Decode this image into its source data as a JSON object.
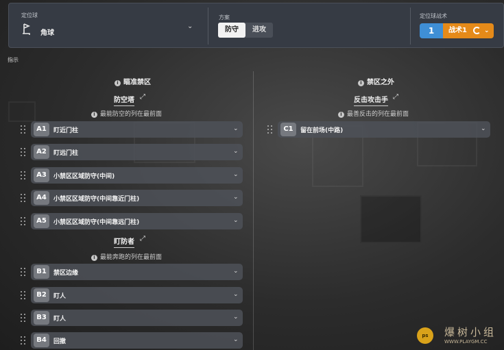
{
  "header": {
    "category_label": "定位球",
    "category_value": "角球",
    "plan_label": "方案",
    "plan_tabs": [
      {
        "label": "防守",
        "active": true
      },
      {
        "label": "进攻",
        "active": false
      }
    ],
    "tactic_label": "定位球战术",
    "tactic_number": "1",
    "tactic_name": "战术1",
    "colors": {
      "tactic_number_bg": "#3f8fd6",
      "tactic_name_bg": "#e58a19"
    }
  },
  "instructions_label": "指示",
  "left": {
    "title": "瞄准禁区",
    "groups": [
      {
        "title": "防空塔",
        "hint": "最能防空的列在最前面",
        "rows": [
          {
            "code": "A1",
            "label": "盯近门柱"
          },
          {
            "code": "A2",
            "label": "盯远门柱"
          },
          {
            "code": "A3",
            "label": "小禁区区域防守(中间)"
          },
          {
            "code": "A4",
            "label": "小禁区区域防守(中间靠近门柱)"
          },
          {
            "code": "A5",
            "label": "小禁区区域防守(中间靠远门柱)"
          }
        ]
      },
      {
        "title": "盯防者",
        "hint": "最能奔跑的列在最前面",
        "rows": [
          {
            "code": "B1",
            "label": "禁区边缘"
          },
          {
            "code": "B2",
            "label": "盯人"
          },
          {
            "code": "B3",
            "label": "盯人"
          },
          {
            "code": "B4",
            "label": "回撤"
          }
        ]
      }
    ]
  },
  "right": {
    "title": "禁区之外",
    "groups": [
      {
        "title": "反击攻击手",
        "hint": "最善反击的列在最前面",
        "rows": [
          {
            "code": "C1",
            "label": "留在前场(中路)"
          }
        ]
      }
    ]
  },
  "watermark": {
    "text": "爆树小组",
    "url": "WWW.PLAYGM.CC",
    "logo": "ps"
  },
  "icons": {
    "category": "corner-flag-icon",
    "dropdown": "chevron-down-icon",
    "swap": "swap-arrows-icon",
    "info": "info-icon",
    "drag": "drag-handle-icon",
    "col_left": "info-icon",
    "col_right": "info-icon"
  }
}
